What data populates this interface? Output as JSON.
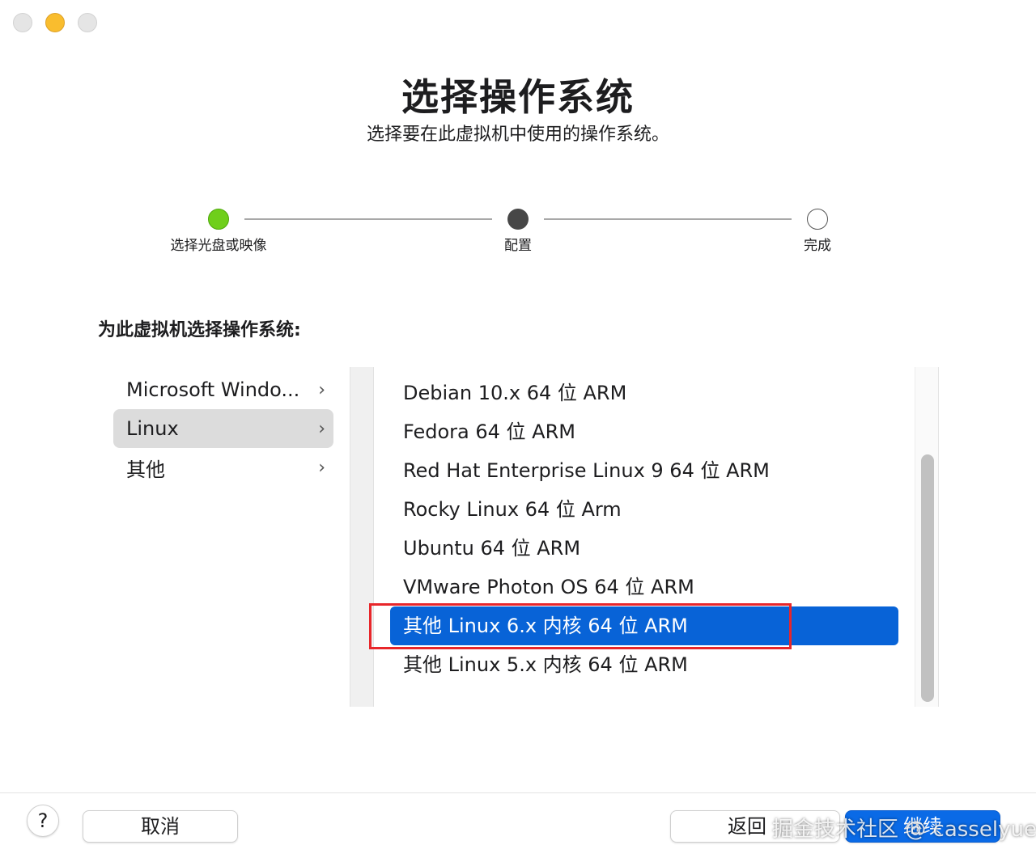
{
  "window": {
    "controls": [
      "close-icon",
      "minimize-icon",
      "zoom-icon"
    ]
  },
  "header": {
    "title": "选择操作系统",
    "subtitle": "选择要在此虚拟机中使用的操作系统。"
  },
  "stepper": {
    "steps": [
      {
        "label": "选择光盘或映像",
        "state": "done"
      },
      {
        "label": "配置",
        "state": "current"
      },
      {
        "label": "完成",
        "state": "todo"
      }
    ]
  },
  "main": {
    "prompt": "为此虚拟机选择操作系统:",
    "categories": [
      {
        "label": "Microsoft Windo...",
        "selected": false
      },
      {
        "label": "Linux",
        "selected": true
      },
      {
        "label": "其他",
        "selected": false
      }
    ],
    "os_list": [
      {
        "label": "Debian 10.x 64 位 ARM",
        "selected": false
      },
      {
        "label": "Fedora 64 位 ARM",
        "selected": false
      },
      {
        "label": "Red Hat Enterprise Linux 9 64 位 ARM",
        "selected": false
      },
      {
        "label": "Rocky Linux 64 位 Arm",
        "selected": false
      },
      {
        "label": "Ubuntu 64 位 ARM",
        "selected": false
      },
      {
        "label": "VMware Photon OS 64 位 ARM",
        "selected": false
      },
      {
        "label": "其他 Linux 6.x 内核 64 位 ARM",
        "selected": true
      },
      {
        "label": "其他 Linux 5.x 内核 64 位 ARM",
        "selected": false
      }
    ]
  },
  "footer": {
    "help_label": "?",
    "cancel_label": "取消",
    "back_label": "返回",
    "continue_label": "继续",
    "watermark": "掘金技术社区 @ casselyue"
  },
  "colors": {
    "accent": "#0863d7",
    "step_done": "#6fcf1b",
    "highlight_box": "#e8262a"
  }
}
